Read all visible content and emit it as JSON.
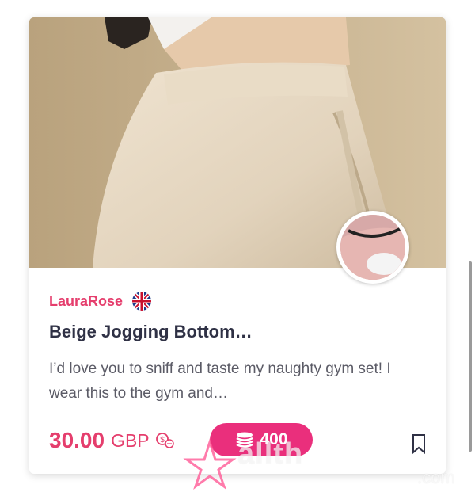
{
  "listing": {
    "seller_name": "LauraRose",
    "seller_flag": "uk-flag-icon",
    "title": "Beige Jogging Bottom…",
    "description": "I’d love you to sniff and taste my naughty gym set! I wear this to the gym and…",
    "price_amount": "30.00",
    "price_currency": "GBP",
    "coin_amount": "400",
    "accent_color": "#e53e6d",
    "pill_color": "#ea2f7c"
  },
  "icons": {
    "currency_convert": "currency-convert-icon",
    "coins": "coins-icon",
    "bookmark": "bookmark-icon"
  },
  "watermark": {
    "text": "allth",
    "sub": ".com"
  }
}
